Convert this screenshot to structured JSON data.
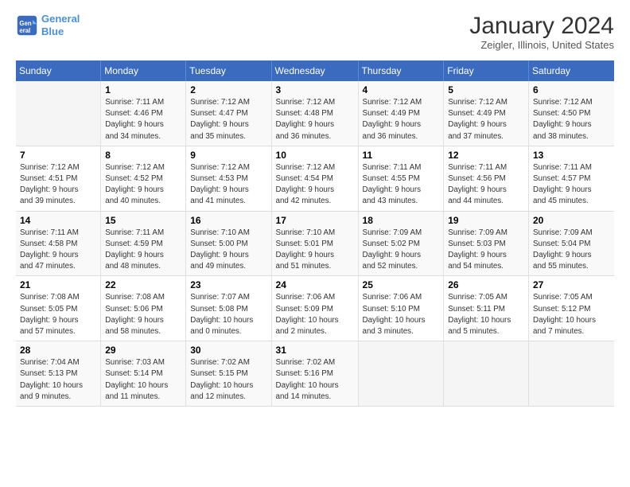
{
  "header": {
    "logo_line1": "General",
    "logo_line2": "Blue",
    "title": "January 2024",
    "subtitle": "Zeigler, Illinois, United States"
  },
  "columns": [
    "Sunday",
    "Monday",
    "Tuesday",
    "Wednesday",
    "Thursday",
    "Friday",
    "Saturday"
  ],
  "rows": [
    [
      {
        "num": "",
        "info": ""
      },
      {
        "num": "1",
        "info": "Sunrise: 7:11 AM\nSunset: 4:46 PM\nDaylight: 9 hours\nand 34 minutes."
      },
      {
        "num": "2",
        "info": "Sunrise: 7:12 AM\nSunset: 4:47 PM\nDaylight: 9 hours\nand 35 minutes."
      },
      {
        "num": "3",
        "info": "Sunrise: 7:12 AM\nSunset: 4:48 PM\nDaylight: 9 hours\nand 36 minutes."
      },
      {
        "num": "4",
        "info": "Sunrise: 7:12 AM\nSunset: 4:49 PM\nDaylight: 9 hours\nand 36 minutes."
      },
      {
        "num": "5",
        "info": "Sunrise: 7:12 AM\nSunset: 4:49 PM\nDaylight: 9 hours\nand 37 minutes."
      },
      {
        "num": "6",
        "info": "Sunrise: 7:12 AM\nSunset: 4:50 PM\nDaylight: 9 hours\nand 38 minutes."
      }
    ],
    [
      {
        "num": "7",
        "info": "Sunrise: 7:12 AM\nSunset: 4:51 PM\nDaylight: 9 hours\nand 39 minutes."
      },
      {
        "num": "8",
        "info": "Sunrise: 7:12 AM\nSunset: 4:52 PM\nDaylight: 9 hours\nand 40 minutes."
      },
      {
        "num": "9",
        "info": "Sunrise: 7:12 AM\nSunset: 4:53 PM\nDaylight: 9 hours\nand 41 minutes."
      },
      {
        "num": "10",
        "info": "Sunrise: 7:12 AM\nSunset: 4:54 PM\nDaylight: 9 hours\nand 42 minutes."
      },
      {
        "num": "11",
        "info": "Sunrise: 7:11 AM\nSunset: 4:55 PM\nDaylight: 9 hours\nand 43 minutes."
      },
      {
        "num": "12",
        "info": "Sunrise: 7:11 AM\nSunset: 4:56 PM\nDaylight: 9 hours\nand 44 minutes."
      },
      {
        "num": "13",
        "info": "Sunrise: 7:11 AM\nSunset: 4:57 PM\nDaylight: 9 hours\nand 45 minutes."
      }
    ],
    [
      {
        "num": "14",
        "info": "Sunrise: 7:11 AM\nSunset: 4:58 PM\nDaylight: 9 hours\nand 47 minutes."
      },
      {
        "num": "15",
        "info": "Sunrise: 7:11 AM\nSunset: 4:59 PM\nDaylight: 9 hours\nand 48 minutes."
      },
      {
        "num": "16",
        "info": "Sunrise: 7:10 AM\nSunset: 5:00 PM\nDaylight: 9 hours\nand 49 minutes."
      },
      {
        "num": "17",
        "info": "Sunrise: 7:10 AM\nSunset: 5:01 PM\nDaylight: 9 hours\nand 51 minutes."
      },
      {
        "num": "18",
        "info": "Sunrise: 7:09 AM\nSunset: 5:02 PM\nDaylight: 9 hours\nand 52 minutes."
      },
      {
        "num": "19",
        "info": "Sunrise: 7:09 AM\nSunset: 5:03 PM\nDaylight: 9 hours\nand 54 minutes."
      },
      {
        "num": "20",
        "info": "Sunrise: 7:09 AM\nSunset: 5:04 PM\nDaylight: 9 hours\nand 55 minutes."
      }
    ],
    [
      {
        "num": "21",
        "info": "Sunrise: 7:08 AM\nSunset: 5:05 PM\nDaylight: 9 hours\nand 57 minutes."
      },
      {
        "num": "22",
        "info": "Sunrise: 7:08 AM\nSunset: 5:06 PM\nDaylight: 9 hours\nand 58 minutes."
      },
      {
        "num": "23",
        "info": "Sunrise: 7:07 AM\nSunset: 5:08 PM\nDaylight: 10 hours\nand 0 minutes."
      },
      {
        "num": "24",
        "info": "Sunrise: 7:06 AM\nSunset: 5:09 PM\nDaylight: 10 hours\nand 2 minutes."
      },
      {
        "num": "25",
        "info": "Sunrise: 7:06 AM\nSunset: 5:10 PM\nDaylight: 10 hours\nand 3 minutes."
      },
      {
        "num": "26",
        "info": "Sunrise: 7:05 AM\nSunset: 5:11 PM\nDaylight: 10 hours\nand 5 minutes."
      },
      {
        "num": "27",
        "info": "Sunrise: 7:05 AM\nSunset: 5:12 PM\nDaylight: 10 hours\nand 7 minutes."
      }
    ],
    [
      {
        "num": "28",
        "info": "Sunrise: 7:04 AM\nSunset: 5:13 PM\nDaylight: 10 hours\nand 9 minutes."
      },
      {
        "num": "29",
        "info": "Sunrise: 7:03 AM\nSunset: 5:14 PM\nDaylight: 10 hours\nand 11 minutes."
      },
      {
        "num": "30",
        "info": "Sunrise: 7:02 AM\nSunset: 5:15 PM\nDaylight: 10 hours\nand 12 minutes."
      },
      {
        "num": "31",
        "info": "Sunrise: 7:02 AM\nSunset: 5:16 PM\nDaylight: 10 hours\nand 14 minutes."
      },
      {
        "num": "",
        "info": ""
      },
      {
        "num": "",
        "info": ""
      },
      {
        "num": "",
        "info": ""
      }
    ]
  ]
}
